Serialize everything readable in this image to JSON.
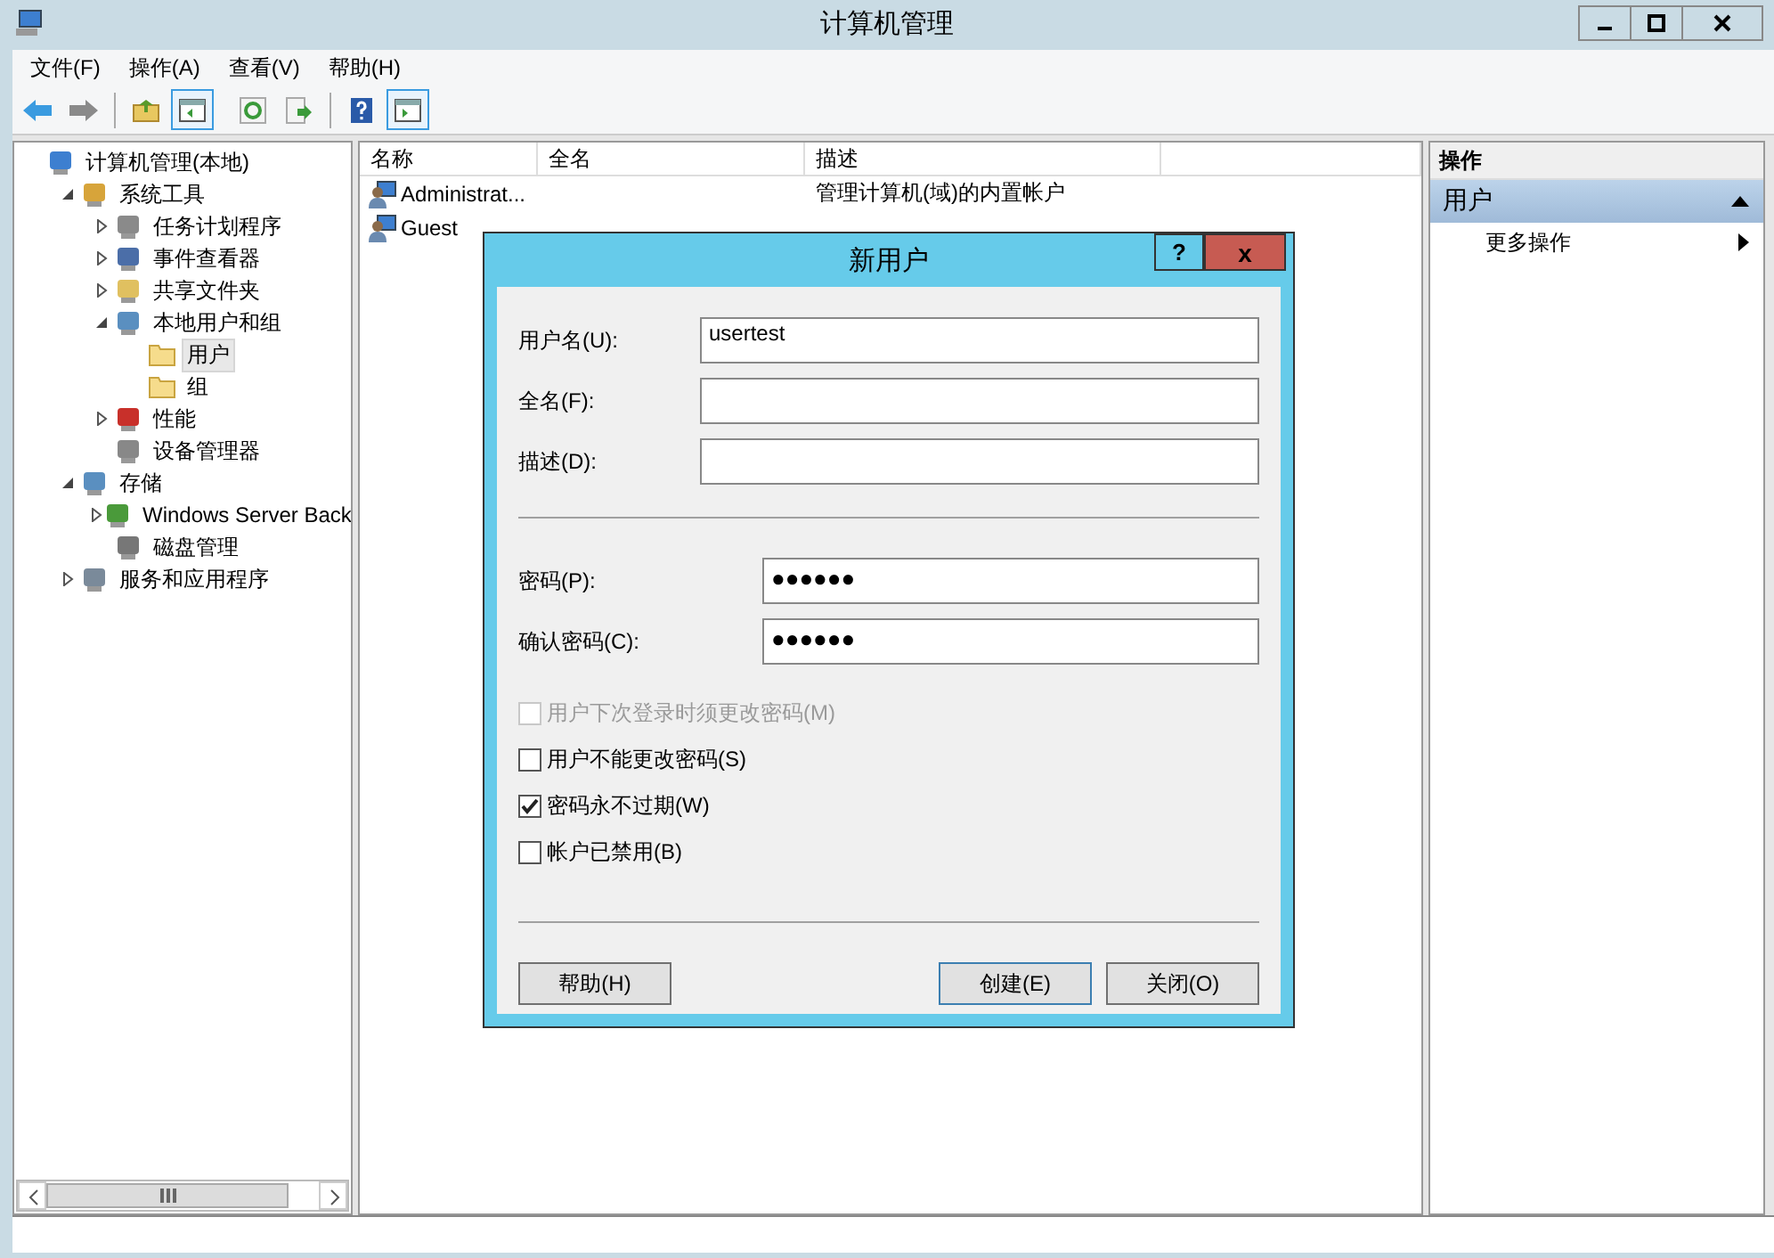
{
  "window": {
    "title": "计算机管理"
  },
  "menu": [
    "文件(F)",
    "操作(A)",
    "查看(V)",
    "帮助(H)"
  ],
  "tree": [
    {
      "label": "计算机管理(本地)",
      "selected": false,
      "children": [
        {
          "label": "系统工具",
          "expanded": true,
          "selected": false,
          "children": [
            {
              "label": "任务计划程序",
              "expanded": false,
              "selected": false
            },
            {
              "label": "事件查看器",
              "expanded": false,
              "selected": false
            },
            {
              "label": "共享文件夹",
              "expanded": false,
              "selected": false
            },
            {
              "label": "本地用户和组",
              "expanded": true,
              "selected": false,
              "children": [
                {
                  "label": "用户",
                  "selected": true
                },
                {
                  "label": "组",
                  "selected": false
                }
              ]
            },
            {
              "label": "性能",
              "expanded": false,
              "selected": false
            },
            {
              "label": "设备管理器",
              "selected": false
            }
          ]
        },
        {
          "label": "存储",
          "expanded": true,
          "selected": false,
          "children": [
            {
              "label": "Windows Server Back",
              "expanded": false,
              "selected": false
            },
            {
              "label": "磁盘管理",
              "selected": false
            }
          ]
        },
        {
          "label": "服务和应用程序",
          "expanded": false,
          "selected": false
        }
      ]
    }
  ],
  "list": {
    "columns": [
      "名称",
      "全名",
      "描述"
    ],
    "rows": [
      {
        "name": "Administrat...",
        "full_name": "",
        "description": "管理计算机(域)的内置帐户"
      },
      {
        "name": "Guest",
        "full_name": ""
      }
    ]
  },
  "actions": {
    "title": "操作",
    "section": "用户",
    "items": [
      {
        "label": "更多操作"
      }
    ]
  },
  "dialog": {
    "title": "新用户",
    "help": "?",
    "close": "x",
    "fields": [
      {
        "label": "用户名(U):",
        "value": "usertest",
        "kind": "text"
      },
      {
        "label": "全名(F):",
        "kind": "text"
      },
      {
        "label": "描述(D):",
        "kind": "text"
      },
      {
        "label": "密码(P):",
        "value": "●●●●●●",
        "kind": "password"
      },
      {
        "label": "确认密码(C):",
        "value": "●●●●●●",
        "kind": "password"
      }
    ],
    "options": [
      {
        "label": "用户下次登录时须更改密码(M)",
        "checked": false,
        "disabled": true
      },
      {
        "label": "用户不能更改密码(S)",
        "checked": false,
        "disabled": false
      },
      {
        "label": "密码永不过期(W)",
        "checked": true,
        "disabled": false
      },
      {
        "label": "帐户已禁用(B)",
        "checked": false,
        "disabled": false
      }
    ],
    "buttons": [
      {
        "label": "帮助(H)",
        "default": false
      },
      {
        "label": "创建(E)",
        "default": true
      },
      {
        "label": "关闭(O)",
        "default": false
      }
    ]
  }
}
